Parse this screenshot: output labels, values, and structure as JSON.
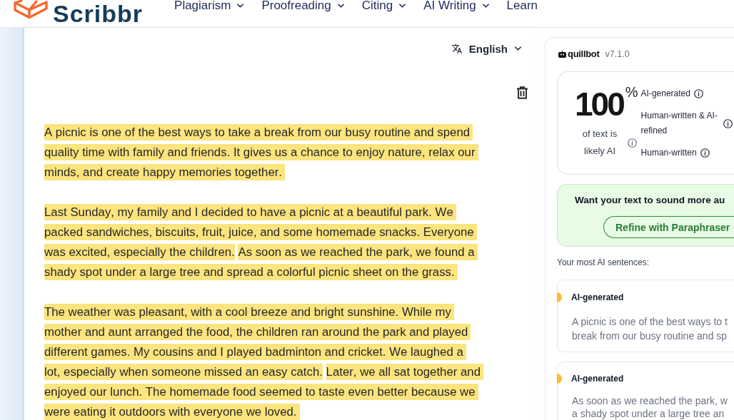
{
  "header": {
    "logo": "Scribbr",
    "nav": [
      {
        "label": "Plagiarism",
        "dropdown": true
      },
      {
        "label": "Proofreading",
        "dropdown": true
      },
      {
        "label": "Citing",
        "dropdown": true
      },
      {
        "label": "AI Writing",
        "dropdown": true
      },
      {
        "label": "Learn",
        "dropdown": false
      }
    ]
  },
  "editor": {
    "language": "English",
    "paragraphs": [
      {
        "lines": [
          {
            "runs": [
              {
                "text": "A picnic is one of the best ways to take a break from our busy routine and spend",
                "highlighted": true
              }
            ]
          },
          {
            "runs": [
              {
                "text": "quality time with family and friends. It gives us a chance to enjoy nature, relax our",
                "highlighted": true
              }
            ]
          },
          {
            "runs": [
              {
                "text": "minds, and create happy memories together.",
                "highlighted": true
              }
            ]
          }
        ]
      },
      {
        "lines": [
          {
            "runs": [
              {
                "text": "Last Sunday, my family and I decided to have a picnic at a beautiful park. We",
                "highlighted": true
              }
            ]
          },
          {
            "runs": [
              {
                "text": "packed sandwiches, biscuits, fruit, juice, and some homemade snacks. Everyone",
                "highlighted": true
              }
            ]
          },
          {
            "runs": [
              {
                "text": "was excited, especially the children.",
                "highlighted": true
              },
              {
                "text": "As soon as we reached the park, we found a",
                "highlighted": true
              }
            ]
          },
          {
            "runs": [
              {
                "text": "shady spot under a large tree and spread a colorful picnic sheet on the grass.",
                "highlighted": true
              }
            ]
          }
        ]
      },
      {
        "lines": [
          {
            "runs": [
              {
                "text": "The weather was pleasant, with a cool breeze and bright sunshine. While my",
                "highlighted": true
              }
            ]
          },
          {
            "runs": [
              {
                "text": "mother and aunt arranged the food, the children ran around the park and played",
                "highlighted": true
              }
            ]
          },
          {
            "runs": [
              {
                "text": "different games. My cousins and I played badminton and cricket. We laughed a",
                "highlighted": true
              }
            ]
          },
          {
            "runs": [
              {
                "text": "lot, especially when someone missed an easy catch.",
                "highlighted": true
              },
              {
                "text": "Later, we all sat together and",
                "highlighted": true
              }
            ]
          },
          {
            "runs": [
              {
                "text": "enjoyed our lunch. The homemade food seemed to taste even better because we",
                "highlighted": true
              }
            ]
          },
          {
            "runs": [
              {
                "text": "were eating it outdoors with everyone we loved.",
                "highlighted": true
              }
            ]
          }
        ]
      }
    ]
  },
  "detector": {
    "brand": "quillbot",
    "version": "v7.1.0",
    "score": "100",
    "score_unit": "%",
    "score_caption": "of text is likely AI",
    "categories": [
      {
        "label": "AI-generated"
      },
      {
        "label": "Human-written & AI-refined"
      },
      {
        "label": "Human-written"
      }
    ],
    "prompt": {
      "text": "Want your text to sound more au",
      "button": "Refine with Paraphraser"
    },
    "sentences_heading": "Your most AI sentences:",
    "sentences": [
      {
        "label": "AI-generated",
        "color": "#fdbb35",
        "text": "A picnic is one of the best ways to t\nbreak from our busy routine and sp"
      },
      {
        "label": "AI-generated",
        "color": "#fdbb35",
        "text": "As soon as we reached the park, w\na shady spot under a large tree an"
      }
    ]
  }
}
